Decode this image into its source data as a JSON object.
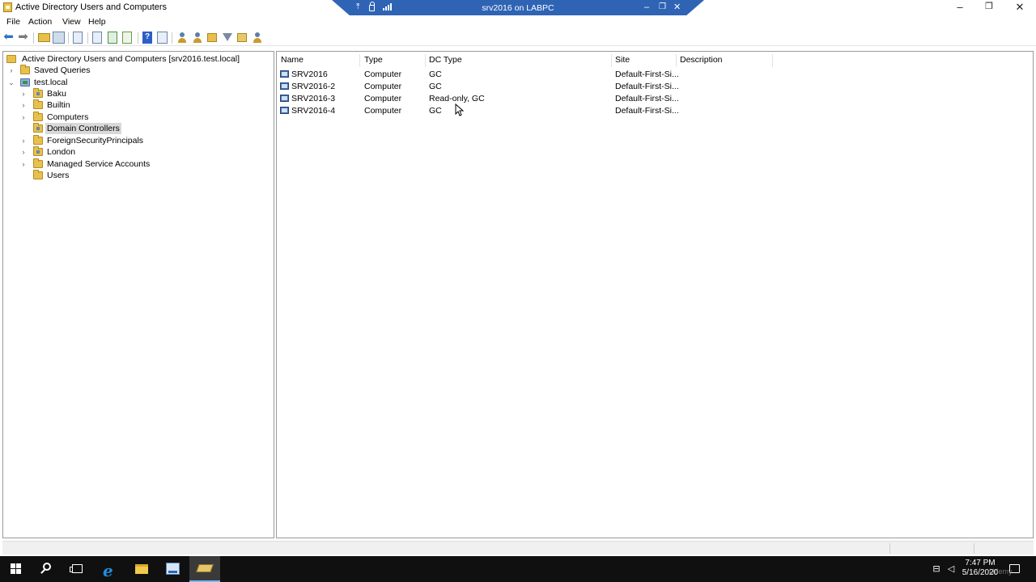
{
  "window": {
    "title": "Active Directory Users and Computers",
    "controls": {
      "minimize": "–",
      "maximize": "❐",
      "close": "✕"
    }
  },
  "rdp_bar": {
    "title": "srv2016 on LABPC",
    "icons": [
      "pin-icon",
      "lock-icon",
      "signal-icon"
    ],
    "controls": {
      "minimize": "–",
      "restore": "❐",
      "close": "✕"
    },
    "color": "#2f64b5"
  },
  "menu": [
    "File",
    "Action",
    "View",
    "Help"
  ],
  "toolbar": {
    "buttons": [
      "back-icon",
      "forward-icon",
      "up-folder-icon",
      "show-console-tree-icon",
      "delete-icon",
      "properties-icon",
      "refresh-icon",
      "export-list-icon",
      "help-icon",
      "show-action-pane-icon",
      "new-user-icon",
      "new-group-icon",
      "new-ou-icon",
      "filter-icon",
      "delegate-control-icon",
      "find-icon"
    ]
  },
  "tree": {
    "root": "Active Directory Users and Computers [srv2016.test.local]",
    "items": [
      {
        "label": "Saved Queries",
        "expander": "›",
        "level": 1,
        "icon": "folder-icon"
      },
      {
        "label": "test.local",
        "expander": "⌄",
        "level": 1,
        "icon": "domain-icon"
      },
      {
        "label": "Baku",
        "expander": "›",
        "level": 2,
        "icon": "ou-icon"
      },
      {
        "label": "Builtin",
        "expander": "›",
        "level": 2,
        "icon": "folder-icon"
      },
      {
        "label": "Computers",
        "expander": "›",
        "level": 2,
        "icon": "folder-icon"
      },
      {
        "label": "Domain Controllers",
        "expander": "",
        "level": 2,
        "icon": "ou-icon",
        "selected": true
      },
      {
        "label": "ForeignSecurityPrincipals",
        "expander": "›",
        "level": 2,
        "icon": "folder-icon"
      },
      {
        "label": "London",
        "expander": "›",
        "level": 2,
        "icon": "ou-icon"
      },
      {
        "label": "Managed Service Accounts",
        "expander": "›",
        "level": 2,
        "icon": "folder-icon"
      },
      {
        "label": "Users",
        "expander": "",
        "level": 2,
        "icon": "folder-icon"
      }
    ]
  },
  "list": {
    "columns": [
      "Name",
      "Type",
      "DC Type",
      "Site",
      "Description"
    ],
    "rows": [
      {
        "name": "SRV2016",
        "type": "Computer",
        "dc_type": "GC",
        "site": "Default-First-Si...",
        "description": ""
      },
      {
        "name": "SRV2016-2",
        "type": "Computer",
        "dc_type": "GC",
        "site": "Default-First-Si...",
        "description": ""
      },
      {
        "name": "SRV2016-3",
        "type": "Computer",
        "dc_type": "Read-only, GC",
        "site": "Default-First-Si...",
        "description": ""
      },
      {
        "name": "SRV2016-4",
        "type": "Computer",
        "dc_type": "GC",
        "site": "Default-First-Si...",
        "description": ""
      }
    ]
  },
  "taskbar": {
    "items": [
      "start-icon",
      "search-icon",
      "task-view-icon",
      "internet-explorer-icon",
      "file-explorer-icon",
      "server-manager-icon",
      "ad-users-computers-icon"
    ],
    "clock": {
      "time": "7:47 PM",
      "date": "5/16/2020"
    },
    "tray_icons": [
      "network-icon",
      "volume-icon",
      "notifications-icon"
    ]
  },
  "watermark": "Udemy"
}
